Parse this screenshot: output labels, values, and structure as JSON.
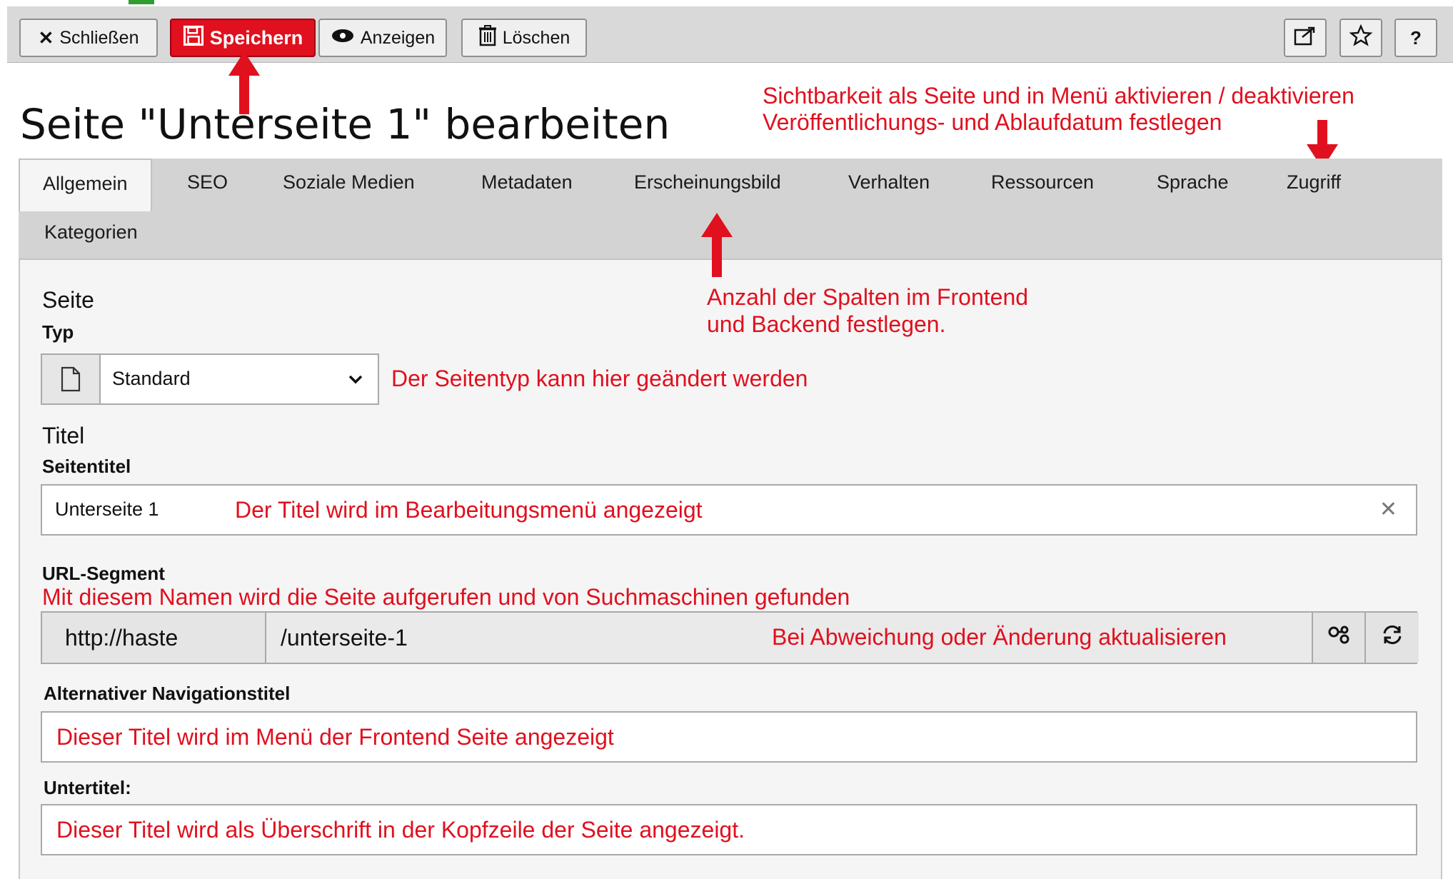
{
  "toolbar": {
    "close_label": "Schließen",
    "save_label": "Speichern",
    "view_label": "Anzeigen",
    "delete_label": "Löschen",
    "help_label": "?",
    "icons": [
      "close-icon",
      "save-icon",
      "eye-icon",
      "trash-icon",
      "external-link-icon",
      "star-icon"
    ]
  },
  "page_title": "Seite \"Unterseite 1\" bearbeiten",
  "tabs": [
    {
      "label": "Allgemein",
      "active": true
    },
    {
      "label": "SEO"
    },
    {
      "label": "Soziale Medien"
    },
    {
      "label": "Metadaten"
    },
    {
      "label": "Erscheinungsbild"
    },
    {
      "label": "Verhalten"
    },
    {
      "label": "Ressourcen"
    },
    {
      "label": "Sprache"
    },
    {
      "label": "Zugriff"
    },
    {
      "label": "Kategorien"
    }
  ],
  "form": {
    "section_page": "Seite",
    "type_label": "Typ",
    "type_value": "Standard",
    "section_title": "Titel",
    "page_title_label": "Seitentitel",
    "page_title_value": "Unterseite 1",
    "url_label": "URL-Segment",
    "url_prefix": "http://haste",
    "url_value": "/unterseite-1",
    "alt_nav_label": "Alternativer Navigationstitel",
    "subtitle_label": "Untertitel:"
  },
  "annotations": {
    "access_line1": "Sichtbarkeit als Seite und in Menü aktivieren / deaktivieren",
    "access_line2": "Veröffentlichungs- und Ablaufdatum festlegen",
    "appearance_line1": "Anzahl der Spalten im Frontend",
    "appearance_line2": "und Backend festlegen.",
    "type_note": "Der Seitentyp kann hier geändert werden",
    "title_note": "Der Titel wird im Bearbeitungsmenü angezeigt",
    "url_note": "Mit diesem Namen wird die Seite aufgerufen und von Suchmaschinen gefunden",
    "url_update_note": "Bei Abweichung oder Änderung aktualisieren",
    "alt_nav_note": "Dieser Titel wird im Menü der Frontend Seite angezeigt",
    "subtitle_note": "Dieser Titel wird als Überschrift in der Kopfzeile der Seite angezeigt."
  },
  "colors": {
    "annotation": "#e0101e",
    "save_button": "#e0101e",
    "toolbar_bg": "#d9d9d9",
    "tab_bar_bg": "#d3d3d3",
    "panel_bg": "#f5f5f5"
  }
}
